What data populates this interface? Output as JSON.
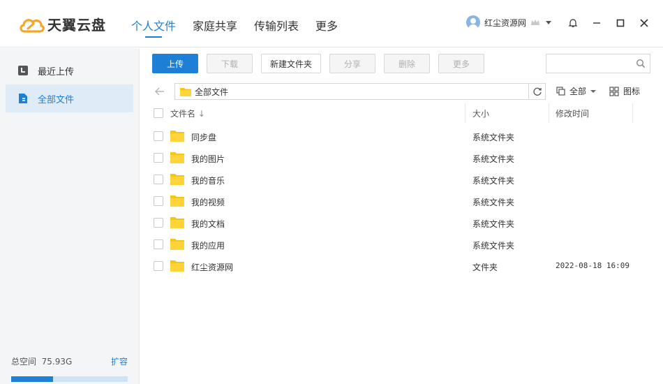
{
  "app": {
    "brand": "天翼云盘",
    "brand_color": "#f5a623",
    "accent": "#1e7fd6"
  },
  "nav": {
    "tabs": [
      {
        "label": "个人文件",
        "active": true
      },
      {
        "label": "家庭共享",
        "active": false
      },
      {
        "label": "传输列表",
        "active": false
      },
      {
        "label": "更多",
        "active": false
      }
    ]
  },
  "user": {
    "name": "红尘资源网",
    "icon": "avatar-icon"
  },
  "window_controls": [
    "bell-icon",
    "minimize-icon",
    "maximize-icon",
    "close-icon"
  ],
  "sidebar": {
    "items": [
      {
        "label": "最近上传",
        "icon": "recent-icon",
        "active": false
      },
      {
        "label": "全部文件",
        "icon": "file-icon",
        "active": true
      }
    ],
    "storage": {
      "label": "总空间",
      "value": "75.93G",
      "expand_label": "扩容",
      "used_fraction": 0.36
    }
  },
  "toolbar": {
    "upload": "上传",
    "download": "下载",
    "new_folder": "新建文件夹",
    "share": "分享",
    "delete": "删除",
    "more": "更多"
  },
  "search": {
    "placeholder": ""
  },
  "path": {
    "current": "全部文件"
  },
  "view": {
    "filter_label": "全部",
    "mode_label": "图标"
  },
  "table": {
    "headers": {
      "name": "文件名",
      "sort_indicator": "↓",
      "size": "大小",
      "modified": "修改时间"
    },
    "rows": [
      {
        "name": "同步盘",
        "size": "系统文件夹",
        "modified": ""
      },
      {
        "name": "我的图片",
        "size": "系统文件夹",
        "modified": ""
      },
      {
        "name": "我的音乐",
        "size": "系统文件夹",
        "modified": ""
      },
      {
        "name": "我的视频",
        "size": "系统文件夹",
        "modified": ""
      },
      {
        "name": "我的文档",
        "size": "系统文件夹",
        "modified": ""
      },
      {
        "name": "我的应用",
        "size": "系统文件夹",
        "modified": ""
      },
      {
        "name": "红尘资源网",
        "size": "文件夹",
        "modified": "2022-08-18 16:09"
      }
    ]
  }
}
